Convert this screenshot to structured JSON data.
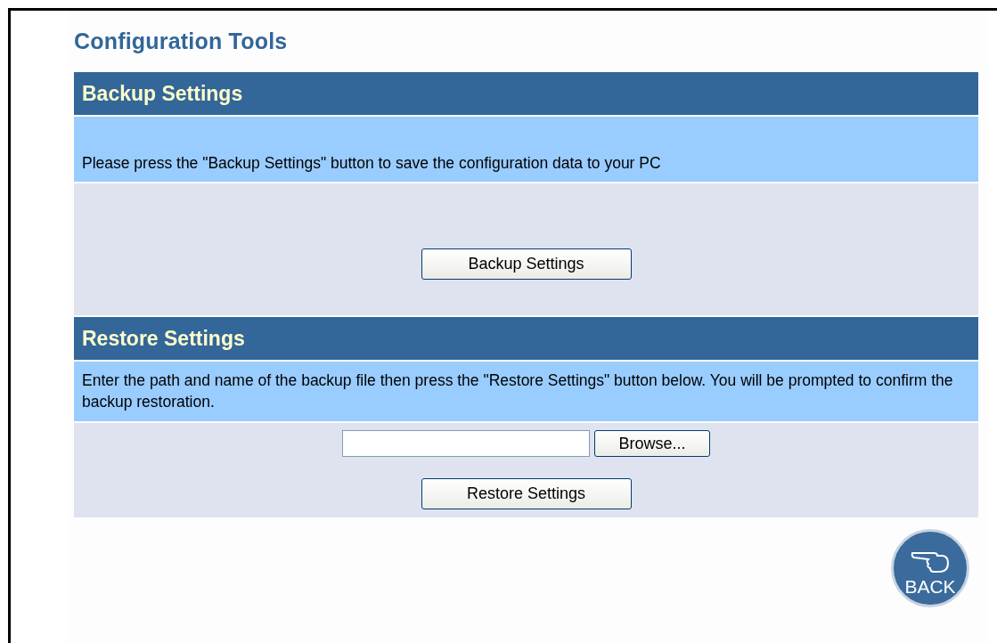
{
  "title": "Configuration Tools",
  "sections": [
    {
      "heading": "Backup Settings",
      "description": "Please press the \"Backup Settings\" button to save the configuration data to your PC",
      "button": "Backup Settings"
    },
    {
      "heading": "Restore Settings",
      "description": "Enter the path and name of the backup file then press the \"Restore Settings\" button below. You will be prompted to confirm the backup restoration.",
      "file_field": {
        "browse": "Browse..."
      },
      "button": "Restore Settings"
    }
  ],
  "back_button": "BACK"
}
